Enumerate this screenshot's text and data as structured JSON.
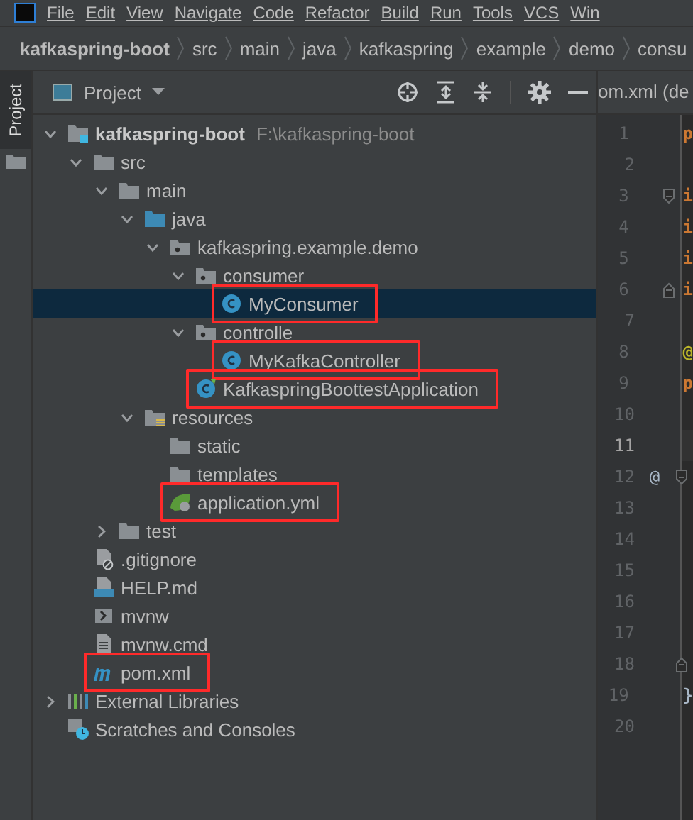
{
  "menu_bar": [
    "File",
    "Edit",
    "View",
    "Navigate",
    "Code",
    "Refactor",
    "Build",
    "Run",
    "Tools",
    "VCS",
    "Win"
  ],
  "breadcrumbs": [
    "kafkaspring-boot",
    "src",
    "main",
    "java",
    "kafkaspring",
    "example",
    "demo",
    "consu"
  ],
  "tool_stripe": {
    "label": "Project"
  },
  "project_panel": {
    "view_selector": "Project",
    "tree": [
      {
        "label": "kafkaspring-boot",
        "path": "F:\\kafkaspring-boot",
        "kind": "module",
        "expanded": true,
        "selected": false,
        "annotated": false,
        "children": [
          {
            "label": "src",
            "kind": "folder",
            "expanded": true,
            "selected": false,
            "annotated": false,
            "children": [
              {
                "label": "main",
                "kind": "folder",
                "expanded": true,
                "selected": false,
                "annotated": false,
                "children": [
                  {
                    "label": "java",
                    "kind": "source-folder",
                    "expanded": true,
                    "selected": false,
                    "annotated": false,
                    "children": [
                      {
                        "label": "kafkaspring.example.demo",
                        "kind": "package",
                        "expanded": true,
                        "selected": false,
                        "annotated": false,
                        "children": [
                          {
                            "label": "consumer",
                            "kind": "package",
                            "expanded": true,
                            "selected": false,
                            "annotated": false,
                            "children": [
                              {
                                "label": "MyConsumer",
                                "kind": "class",
                                "selected": true,
                                "annotated": true
                              }
                            ]
                          },
                          {
                            "label": "controlle",
                            "kind": "package",
                            "expanded": true,
                            "selected": false,
                            "annotated": false,
                            "children": [
                              {
                                "label": "MyKafkaController",
                                "kind": "class",
                                "selected": false,
                                "annotated": true
                              }
                            ]
                          },
                          {
                            "label": "KafkaspringBoottestApplication",
                            "kind": "spring-class",
                            "selected": false,
                            "annotated": true
                          }
                        ]
                      }
                    ]
                  },
                  {
                    "label": "resources",
                    "kind": "resources-folder",
                    "expanded": true,
                    "selected": false,
                    "annotated": false,
                    "children": [
                      {
                        "label": "static",
                        "kind": "folder",
                        "selected": false,
                        "annotated": false
                      },
                      {
                        "label": "templates",
                        "kind": "folder",
                        "selected": false,
                        "annotated": false
                      },
                      {
                        "label": "application.yml",
                        "kind": "yml",
                        "selected": false,
                        "annotated": true
                      }
                    ]
                  }
                ]
              },
              {
                "label": "test",
                "kind": "folder",
                "expanded": false,
                "selected": false,
                "annotated": false
              }
            ]
          },
          {
            "label": ".gitignore",
            "kind": "ignore-file",
            "selected": false,
            "annotated": false
          },
          {
            "label": "HELP.md",
            "kind": "markdown",
            "selected": false,
            "annotated": false
          },
          {
            "label": "mvnw",
            "kind": "script",
            "selected": false,
            "annotated": false
          },
          {
            "label": "mvnw.cmd",
            "kind": "text-file",
            "selected": false,
            "annotated": false
          },
          {
            "label": "pom.xml",
            "kind": "maven",
            "selected": false,
            "annotated": true
          }
        ]
      },
      {
        "label": "External Libraries",
        "kind": "libraries",
        "expanded": false,
        "selected": false,
        "annotated": false
      },
      {
        "label": "Scratches and Consoles",
        "kind": "scratches",
        "selected": false,
        "annotated": false
      }
    ]
  },
  "editor": {
    "tab": "om.xml (de",
    "lines": [
      {
        "number": "1",
        "code": "p",
        "kind": "keyword",
        "current": false
      },
      {
        "number": "2",
        "current": false
      },
      {
        "number": "3",
        "code": "i",
        "kind": "keyword",
        "fold_start": true,
        "current": false
      },
      {
        "number": "4",
        "code": "i",
        "kind": "keyword",
        "current": false
      },
      {
        "number": "5",
        "code": "i",
        "kind": "keyword",
        "current": false
      },
      {
        "number": "6",
        "code": "i",
        "kind": "keyword",
        "fold_end": true,
        "current": false
      },
      {
        "number": "7",
        "current": false
      },
      {
        "number": "8",
        "code": "@",
        "kind": "annotation",
        "current": false
      },
      {
        "number": "9",
        "code": "p",
        "kind": "keyword",
        "current": false
      },
      {
        "number": "10",
        "current": false
      },
      {
        "number": "11",
        "current": true
      },
      {
        "number": "12",
        "gutter_mark": "@",
        "fold_start": true,
        "current": false
      },
      {
        "number": "13",
        "current": false
      },
      {
        "number": "14",
        "current": false
      },
      {
        "number": "15",
        "current": false
      },
      {
        "number": "16",
        "current": false
      },
      {
        "number": "17",
        "current": false
      },
      {
        "number": "18",
        "fold_end": true,
        "current": false
      },
      {
        "number": "19",
        "code": "}",
        "kind": "plain",
        "current": false
      },
      {
        "number": "20",
        "current": false
      }
    ]
  }
}
